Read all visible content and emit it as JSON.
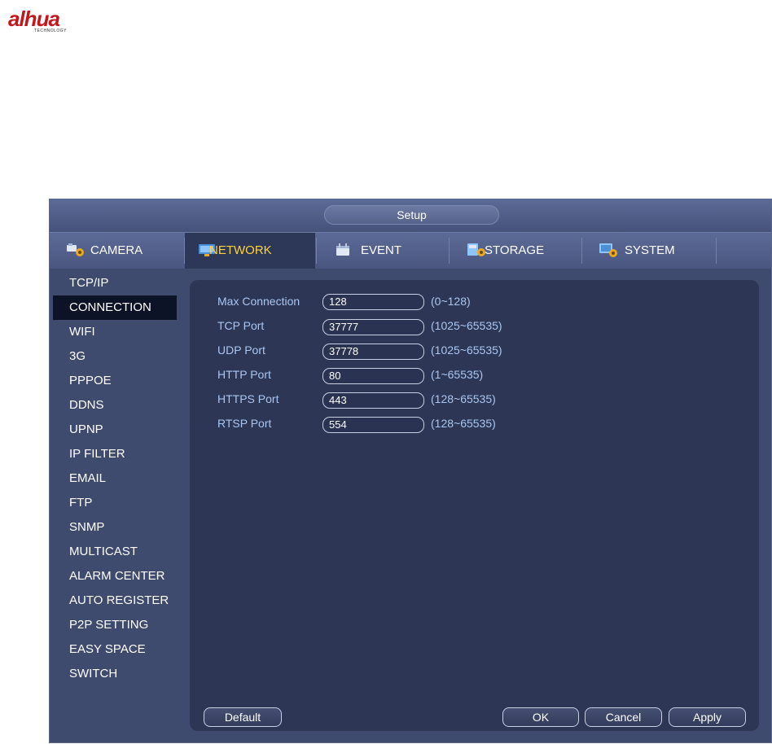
{
  "brand": {
    "name": "alhua",
    "sub": "TECHNOLOGY",
    "color": "#c4161c"
  },
  "window": {
    "title": "Setup"
  },
  "tabs": [
    {
      "label": "CAMERA",
      "icon": "camera-gear-icon"
    },
    {
      "label": "NETWORK",
      "icon": "network-icon",
      "active": true
    },
    {
      "label": "EVENT",
      "icon": "event-icon"
    },
    {
      "label": "STORAGE",
      "icon": "storage-icon"
    },
    {
      "label": "SYSTEM",
      "icon": "system-icon"
    }
  ],
  "sidebar": {
    "items": [
      "TCP/IP",
      "CONNECTION",
      "WIFI",
      "3G",
      "PPPOE",
      "DDNS",
      "UPNP",
      "IP FILTER",
      "EMAIL",
      "FTP",
      "SNMP",
      "MULTICAST",
      "ALARM CENTER",
      "AUTO REGISTER",
      "P2P SETTING",
      "EASY SPACE",
      "SWITCH"
    ],
    "active": "CONNECTION"
  },
  "form": {
    "rows": [
      {
        "label": "Max Connection",
        "value": "128",
        "range": "(0~128)"
      },
      {
        "label": "TCP Port",
        "value": "37777",
        "range": "(1025~65535)"
      },
      {
        "label": "UDP Port",
        "value": "37778",
        "range": "(1025~65535)"
      },
      {
        "label": "HTTP Port",
        "value": "80",
        "range": "(1~65535)"
      },
      {
        "label": "HTTPS Port",
        "value": "443",
        "range": "(128~65535)"
      },
      {
        "label": "RTSP Port",
        "value": "554",
        "range": "(128~65535)"
      }
    ]
  },
  "buttons": {
    "default": "Default",
    "ok": "OK",
    "cancel": "Cancel",
    "apply": "Apply"
  },
  "colors": {
    "active_tab_text": "#ffd23a",
    "label_blue": "#a9c6f3",
    "panel_bg": "#2d3655"
  }
}
